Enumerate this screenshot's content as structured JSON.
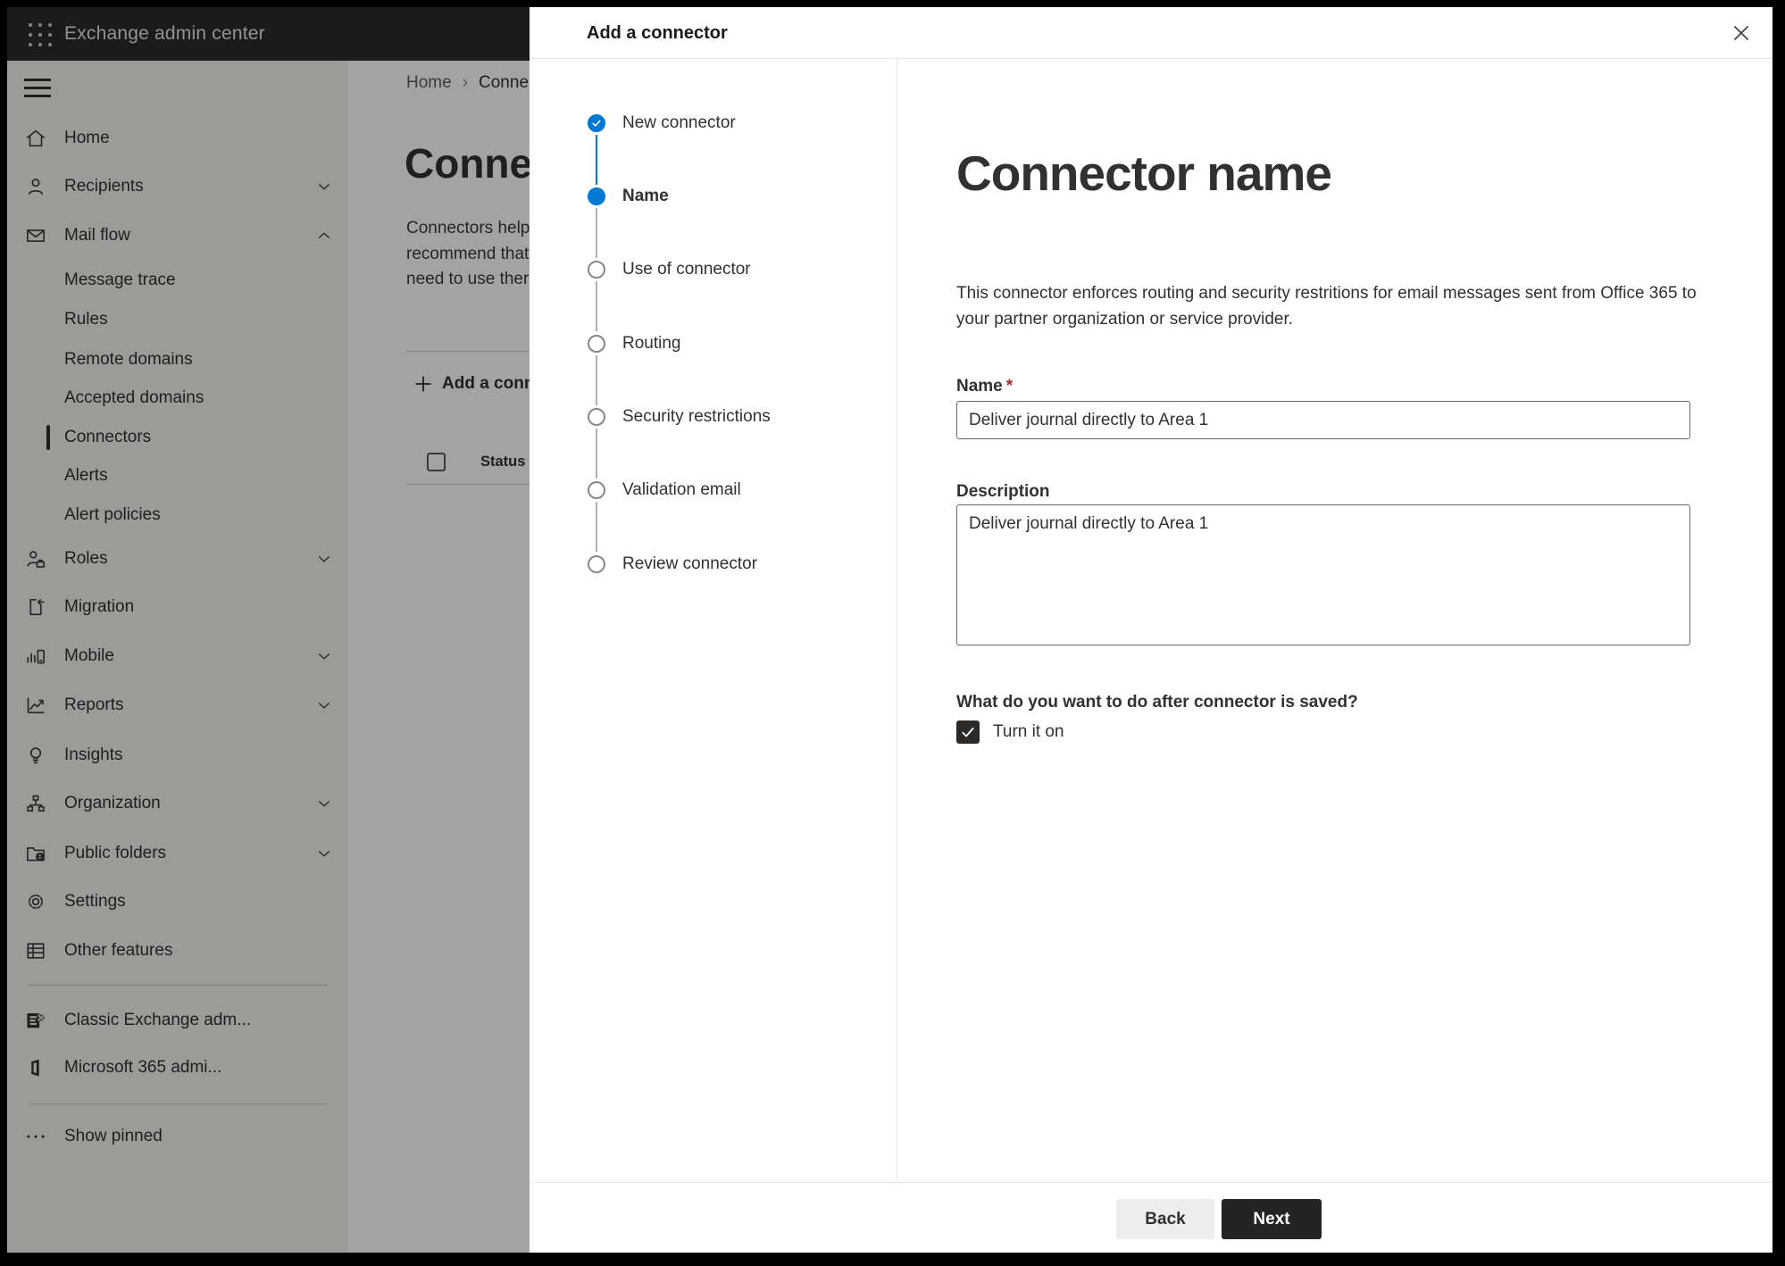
{
  "topbar": {
    "title": "Exchange admin center"
  },
  "sidebar": {
    "items": [
      {
        "label": "Home",
        "icon": "home-icon"
      },
      {
        "label": "Recipients",
        "icon": "person-icon",
        "chevron": "down"
      },
      {
        "label": "Mail flow",
        "icon": "mail-icon",
        "chevron": "up",
        "expanded": true
      },
      {
        "label": "Message trace"
      },
      {
        "label": "Rules"
      },
      {
        "label": "Remote domains"
      },
      {
        "label": "Accepted domains"
      },
      {
        "label": "Connectors",
        "selected": true
      },
      {
        "label": "Alerts"
      },
      {
        "label": "Alert policies"
      },
      {
        "label": "Roles",
        "icon": "roles-icon",
        "chevron": "down"
      },
      {
        "label": "Migration",
        "icon": "migration-icon"
      },
      {
        "label": "Mobile",
        "icon": "mobile-icon",
        "chevron": "down"
      },
      {
        "label": "Reports",
        "icon": "reports-icon",
        "chevron": "down"
      },
      {
        "label": "Insights",
        "icon": "lightbulb-icon"
      },
      {
        "label": "Organization",
        "icon": "org-icon",
        "chevron": "down"
      },
      {
        "label": "Public folders",
        "icon": "folder-globe-icon",
        "chevron": "down"
      },
      {
        "label": "Settings",
        "icon": "gear-icon"
      },
      {
        "label": "Other features",
        "icon": "table-icon"
      },
      {
        "label": "Classic Exchange adm...",
        "icon": "exchange-logo-icon"
      },
      {
        "label": "Microsoft 365 admi...",
        "icon": "office-logo-icon"
      },
      {
        "label": "Show pinned",
        "icon": "ellipsis-icon"
      }
    ]
  },
  "page": {
    "breadcrumb": {
      "home": "Home",
      "separator": "›",
      "current": "Conne"
    },
    "title": "Connec",
    "paragraph_lines": "Connectors help\nrecommend that\nneed to use ther",
    "add_button_label": "Add a conn",
    "status_header": "Status"
  },
  "modal": {
    "title": "Add a connector",
    "steps": [
      {
        "label": "New connector",
        "state": "completed"
      },
      {
        "label": "Name",
        "state": "active"
      },
      {
        "label": "Use of connector",
        "state": "upcoming"
      },
      {
        "label": "Routing",
        "state": "upcoming"
      },
      {
        "label": "Security restrictions",
        "state": "upcoming"
      },
      {
        "label": "Validation email",
        "state": "upcoming"
      },
      {
        "label": "Review connector",
        "state": "upcoming"
      }
    ],
    "content": {
      "heading": "Connector name",
      "description": "This connector enforces routing and security restritions for email messages sent from Office 365 to your partner organization or service provider.",
      "name_label": "Name",
      "required_mark": "*",
      "name_value": "Deliver journal directly to Area 1",
      "description_label": "Description",
      "description_value": "Deliver journal directly to Area 1",
      "question": "What do you want to do after connector is saved?",
      "checkbox_label": "Turn it on",
      "checkbox_checked": true
    },
    "footer": {
      "back_label": "Back",
      "next_label": "Next"
    }
  },
  "colors": {
    "accent": "#0078d4",
    "required": "#a4262c",
    "primary_button": "#242424"
  }
}
